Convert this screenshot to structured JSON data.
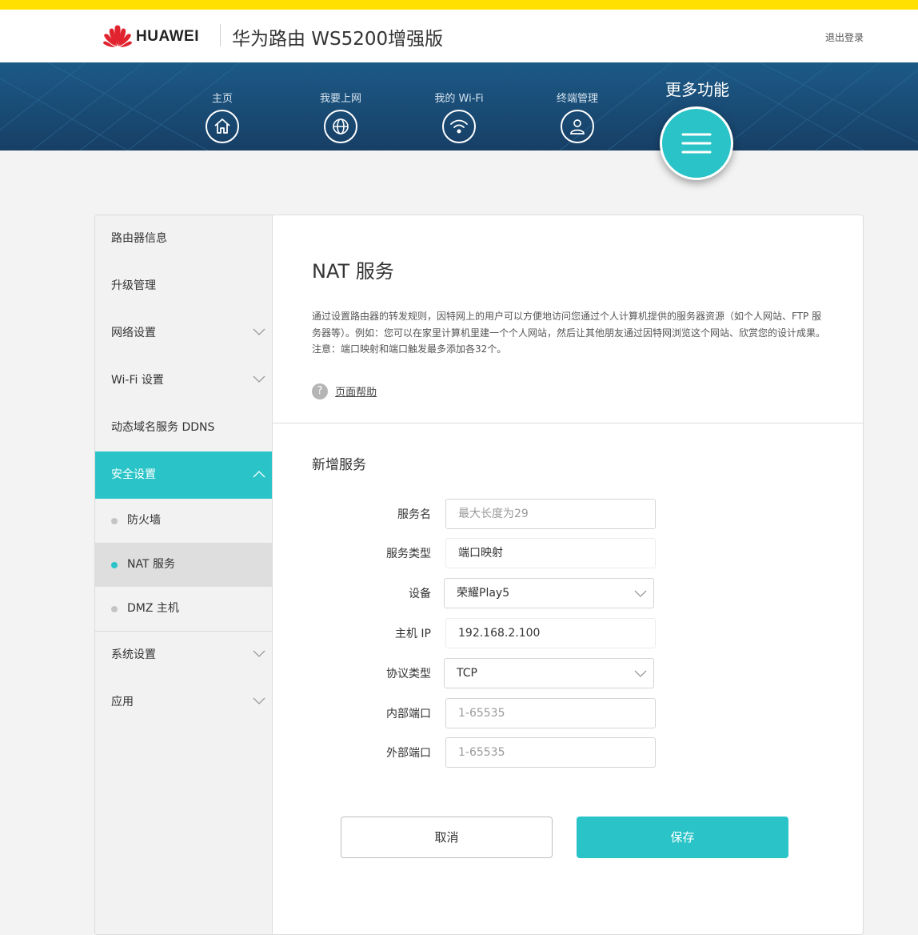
{
  "header": {
    "brand": "HUAWEI",
    "product_title": "华为路由 WS5200增强版",
    "logout": "退出登录"
  },
  "nav": {
    "items": [
      {
        "label": "主页",
        "icon": "home-icon"
      },
      {
        "label": "我要上网",
        "icon": "globe-icon"
      },
      {
        "label": "我的 Wi-Fi",
        "icon": "wifi-icon"
      },
      {
        "label": "终端管理",
        "icon": "user-icon"
      }
    ],
    "more": {
      "label": "更多功能",
      "icon": "menu-icon"
    }
  },
  "sidebar": {
    "items": [
      {
        "label": "路由器信息"
      },
      {
        "label": "升级管理"
      },
      {
        "label": "网络设置",
        "chevron": "down"
      },
      {
        "label": "Wi-Fi 设置",
        "chevron": "down"
      },
      {
        "label": "动态域名服务 DDNS"
      },
      {
        "label": "安全设置",
        "chevron": "up",
        "active": true
      }
    ],
    "subitems": [
      {
        "label": "防火墙"
      },
      {
        "label": "NAT 服务",
        "active": true
      },
      {
        "label": "DMZ 主机"
      }
    ],
    "items_after": [
      {
        "label": "系统设置",
        "chevron": "down"
      },
      {
        "label": "应用",
        "chevron": "down"
      }
    ]
  },
  "main": {
    "title": "NAT 服务",
    "description": "通过设置路由器的转发规则，因特网上的用户可以方便地访问您通过个人计算机提供的服务器资源（如个人网站、FTP 服务器等）。例如：您可以在家里计算机里建一个个人网站，然后让其他朋友通过因特网浏览这个网站、欣赏您的设计成果。注意：端口映射和端口触发最多添加各32个。",
    "help_link": "页面帮助",
    "help_icon": "?",
    "section_title": "新增服务",
    "form": {
      "service_name": {
        "label": "服务名",
        "value": "",
        "placeholder": "最大长度为29"
      },
      "service_type": {
        "label": "服务类型",
        "value": "端口映射"
      },
      "device": {
        "label": "设备",
        "value": "荣耀Play5"
      },
      "host_ip": {
        "label": "主机 IP",
        "value": "192.168.2.100"
      },
      "protocol": {
        "label": "协议类型",
        "value": "TCP"
      },
      "internal_port": {
        "label": "内部端口",
        "value": "",
        "placeholder": "1-65535"
      },
      "external_port": {
        "label": "外部端口",
        "value": "",
        "placeholder": "1-65535"
      }
    },
    "buttons": {
      "cancel": "取消",
      "save": "保存"
    }
  },
  "colors": {
    "accent": "#2ac4c8",
    "nav_bg": "#1b4f7a",
    "top_stripe": "#ffe000",
    "brand_red": "#e0232e",
    "highlight": "#e02020"
  }
}
